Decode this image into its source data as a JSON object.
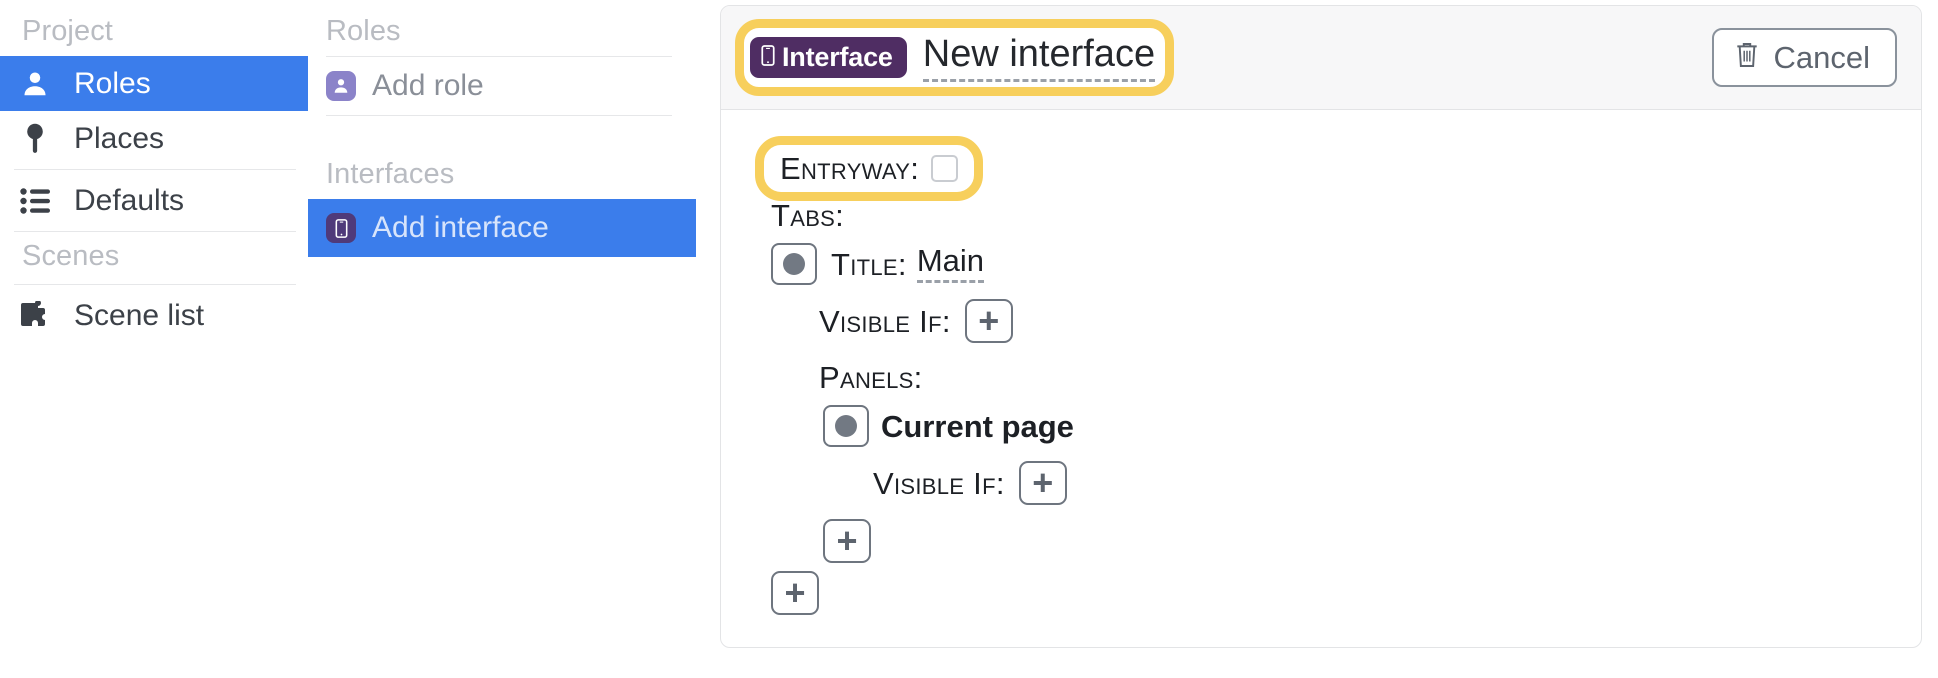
{
  "sidebar": {
    "project_label": "Project",
    "scenes_label": "Scenes",
    "items": [
      {
        "label": "Roles",
        "icon": "person-icon",
        "selected": true
      },
      {
        "label": "Places",
        "icon": "map-pin-icon",
        "selected": false
      },
      {
        "label": "Defaults",
        "icon": "list-icon",
        "selected": false
      },
      {
        "label": "Scene list",
        "icon": "puzzle-piece-icon",
        "selected": false
      }
    ]
  },
  "roles_column": {
    "roles_label": "Roles",
    "interfaces_label": "Interfaces",
    "add_role_label": "Add role",
    "add_interface_label": "Add interface"
  },
  "main": {
    "badge_label": "Interface",
    "title_value": "New interface",
    "cancel_label": "Cancel",
    "entryway_label": "Entryway:",
    "entryway_checked": false,
    "tabs_label": "Tabs:",
    "tab_title_label": "Title:",
    "tab_title_value": "Main",
    "tab_visible_if_label": "Visible If:",
    "panels_label": "Panels:",
    "panel_name": "Current page",
    "panel_visible_if_label": "Visible If:",
    "add_panel_label": "+",
    "add_tab_label": "+",
    "add_visible_if_label": "+"
  },
  "colors": {
    "accent_blue": "#3b7deb",
    "badge_purple": "#4f2d63",
    "role_purple": "#8b83c9",
    "highlight_yellow": "#f7cf5c",
    "muted_text": "#b9bcc2"
  }
}
